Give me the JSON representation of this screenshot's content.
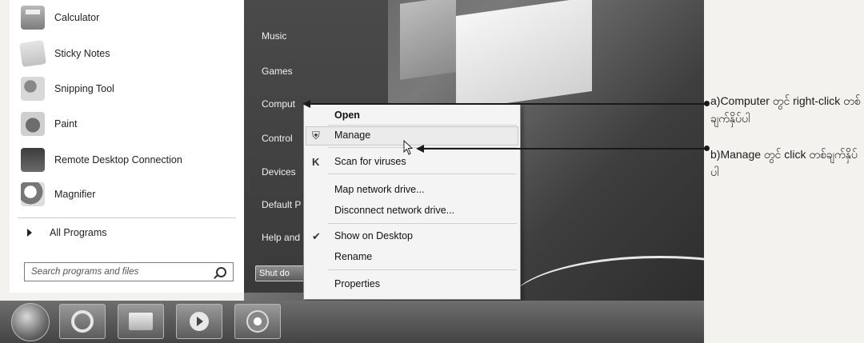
{
  "start_menu": {
    "programs": [
      {
        "label": "Calculator",
        "icon": "calculator-icon"
      },
      {
        "label": "Sticky Notes",
        "icon": "sticky-notes-icon"
      },
      {
        "label": "Snipping Tool",
        "icon": "snipping-tool-icon"
      },
      {
        "label": "Paint",
        "icon": "paint-icon"
      },
      {
        "label": "Remote Desktop Connection",
        "icon": "remote-desktop-icon"
      },
      {
        "label": "Magnifier",
        "icon": "magnifier-icon"
      }
    ],
    "all_programs": "All Programs",
    "search_placeholder": "Search programs and files",
    "right_items": [
      "Music",
      "Games",
      "Comput",
      "Control",
      "Devices",
      "Default P",
      "Help and"
    ],
    "shutdown_label": "Shut do"
  },
  "context_menu": {
    "items": {
      "open": "Open",
      "manage": "Manage",
      "scan": "Scan for viruses",
      "map_drive": "Map network drive...",
      "disconnect_drive": "Disconnect network drive...",
      "show_desktop": "Show on Desktop",
      "rename": "Rename",
      "properties": "Properties"
    },
    "highlighted": "Manage",
    "checked": "Show on Desktop"
  },
  "annotations": {
    "a": "a)Computer တွင် right-click တစ်ချက်နှိပ်ပါ",
    "b": "b)Manage တွင် click တစ်ချက်နှိပ်ပါ"
  }
}
